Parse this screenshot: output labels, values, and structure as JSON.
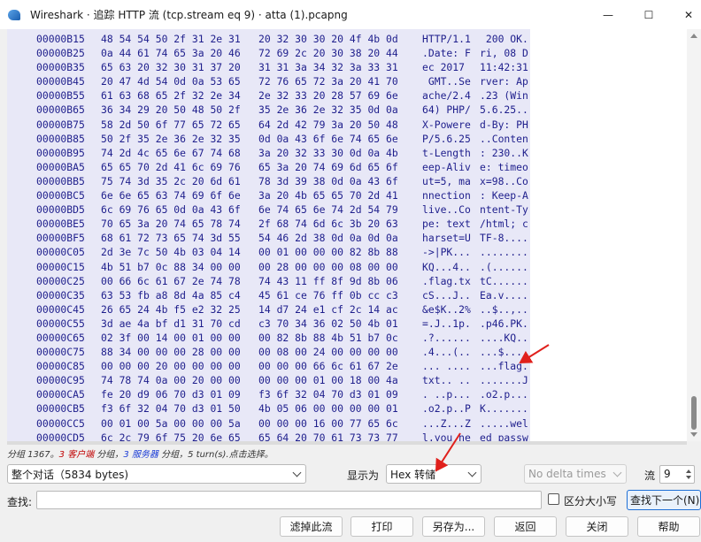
{
  "window": {
    "title": "Wireshark · 追踪 HTTP 流 (tcp.stream eq 9) · atta (1).pcapng",
    "minimize_glyph": "—",
    "maximize_glyph": "☐",
    "close_glyph": "✕",
    "app_icon": "wireshark-fin-icon"
  },
  "hex_dump": {
    "rows": [
      {
        "offset": "00000B15",
        "hex_a": "48 54 54 50 2f 31 2e 31",
        "hex_b": "20 32 30 30 20 4f 4b 0d",
        "ascii_a": "HTTP/1.1",
        "ascii_b": " 200 OK."
      },
      {
        "offset": "00000B25",
        "hex_a": "0a 44 61 74 65 3a 20 46",
        "hex_b": "72 69 2c 20 30 38 20 44",
        "ascii_a": ".Date: F",
        "ascii_b": "ri, 08 D"
      },
      {
        "offset": "00000B35",
        "hex_a": "65 63 20 32 30 31 37 20",
        "hex_b": "31 31 3a 34 32 3a 33 31",
        "ascii_a": "ec 2017 ",
        "ascii_b": "11:42:31"
      },
      {
        "offset": "00000B45",
        "hex_a": "20 47 4d 54 0d 0a 53 65",
        "hex_b": "72 76 65 72 3a 20 41 70",
        "ascii_a": " GMT..Se",
        "ascii_b": "rver: Ap"
      },
      {
        "offset": "00000B55",
        "hex_a": "61 63 68 65 2f 32 2e 34",
        "hex_b": "2e 32 33 20 28 57 69 6e",
        "ascii_a": "ache/2.4",
        "ascii_b": ".23 (Win"
      },
      {
        "offset": "00000B65",
        "hex_a": "36 34 29 20 50 48 50 2f",
        "hex_b": "35 2e 36 2e 32 35 0d 0a",
        "ascii_a": "64) PHP/",
        "ascii_b": "5.6.25.."
      },
      {
        "offset": "00000B75",
        "hex_a": "58 2d 50 6f 77 65 72 65",
        "hex_b": "64 2d 42 79 3a 20 50 48",
        "ascii_a": "X-Powere",
        "ascii_b": "d-By: PH"
      },
      {
        "offset": "00000B85",
        "hex_a": "50 2f 35 2e 36 2e 32 35",
        "hex_b": "0d 0a 43 6f 6e 74 65 6e",
        "ascii_a": "P/5.6.25",
        "ascii_b": "..Conten"
      },
      {
        "offset": "00000B95",
        "hex_a": "74 2d 4c 65 6e 67 74 68",
        "hex_b": "3a 20 32 33 30 0d 0a 4b",
        "ascii_a": "t-Length",
        "ascii_b": ": 230..K"
      },
      {
        "offset": "00000BA5",
        "hex_a": "65 65 70 2d 41 6c 69 76",
        "hex_b": "65 3a 20 74 69 6d 65 6f",
        "ascii_a": "eep-Aliv",
        "ascii_b": "e: timeo"
      },
      {
        "offset": "00000BB5",
        "hex_a": "75 74 3d 35 2c 20 6d 61",
        "hex_b": "78 3d 39 38 0d 0a 43 6f",
        "ascii_a": "ut=5, ma",
        "ascii_b": "x=98..Co"
      },
      {
        "offset": "00000BC5",
        "hex_a": "6e 6e 65 63 74 69 6f 6e",
        "hex_b": "3a 20 4b 65 65 70 2d 41",
        "ascii_a": "nnection",
        "ascii_b": ": Keep-A"
      },
      {
        "offset": "00000BD5",
        "hex_a": "6c 69 76 65 0d 0a 43 6f",
        "hex_b": "6e 74 65 6e 74 2d 54 79",
        "ascii_a": "live..Co",
        "ascii_b": "ntent-Ty"
      },
      {
        "offset": "00000BE5",
        "hex_a": "70 65 3a 20 74 65 78 74",
        "hex_b": "2f 68 74 6d 6c 3b 20 63",
        "ascii_a": "pe: text",
        "ascii_b": "/html; c"
      },
      {
        "offset": "00000BF5",
        "hex_a": "68 61 72 73 65 74 3d 55",
        "hex_b": "54 46 2d 38 0d 0a 0d 0a",
        "ascii_a": "harset=U",
        "ascii_b": "TF-8...."
      },
      {
        "offset": "00000C05",
        "hex_a": "2d 3e 7c 50 4b 03 04 14",
        "hex_b": "00 01 00 00 00 82 8b 88",
        "ascii_a": "->|PK...",
        "ascii_b": "........"
      },
      {
        "offset": "00000C15",
        "hex_a": "4b 51 b7 0c 88 34 00 00",
        "hex_b": "00 28 00 00 00 08 00 00",
        "ascii_a": "KQ...4..",
        "ascii_b": ".(......"
      },
      {
        "offset": "00000C25",
        "hex_a": "00 66 6c 61 67 2e 74 78",
        "hex_b": "74 43 11 ff 8f 9d 8b 06",
        "ascii_a": ".flag.tx",
        "ascii_b": "tC......"
      },
      {
        "offset": "00000C35",
        "hex_a": "63 53 fb a8 8d 4a 85 c4",
        "hex_b": "45 61 ce 76 ff 0b cc c3",
        "ascii_a": "cS...J..",
        "ascii_b": "Ea.v...."
      },
      {
        "offset": "00000C45",
        "hex_a": "26 65 24 4b f5 e2 32 25",
        "hex_b": "14 d7 24 e1 cf 2c 14 ac",
        "ascii_a": "&e$K..2%",
        "ascii_b": "..$..,.."
      },
      {
        "offset": "00000C55",
        "hex_a": "3d ae 4a bf d1 31 70 cd",
        "hex_b": "c3 70 34 36 02 50 4b 01",
        "ascii_a": "=.J..1p.",
        "ascii_b": ".p46.PK."
      },
      {
        "offset": "00000C65",
        "hex_a": "02 3f 00 14 00 01 00 00",
        "hex_b": "00 82 8b 88 4b 51 b7 0c",
        "ascii_a": ".?......",
        "ascii_b": "....KQ.."
      },
      {
        "offset": "00000C75",
        "hex_a": "88 34 00 00 00 28 00 00",
        "hex_b": "00 08 00 24 00 00 00 00",
        "ascii_a": ".4...(..",
        "ascii_b": "...$...."
      },
      {
        "offset": "00000C85",
        "hex_a": "00 00 00 20 00 00 00 00",
        "hex_b": "00 00 00 66 6c 61 67 2e",
        "ascii_a": "... ....",
        "ascii_b": "...flag."
      },
      {
        "offset": "00000C95",
        "hex_a": "74 78 74 0a 00 20 00 00",
        "hex_b": "00 00 00 01 00 18 00 4a",
        "ascii_a": "txt.. ..",
        "ascii_b": ".......J"
      },
      {
        "offset": "00000CA5",
        "hex_a": "fe 20 d9 06 70 d3 01 09",
        "hex_b": "f3 6f 32 04 70 d3 01 09",
        "ascii_a": ". ..p...",
        "ascii_b": ".o2.p..."
      },
      {
        "offset": "00000CB5",
        "hex_a": "f3 6f 32 04 70 d3 01 50",
        "hex_b": "4b 05 06 00 00 00 00 01",
        "ascii_a": ".o2.p..P",
        "ascii_b": "K......."
      },
      {
        "offset": "00000CC5",
        "hex_a": "00 01 00 5a 00 00 00 5a",
        "hex_b": "00 00 00 16 00 77 65 6c",
        "ascii_a": "...Z...Z",
        "ascii_b": ".....wel"
      },
      {
        "offset": "00000CD5",
        "hex_a": "6c 2c 79 6f 75 20 6e 65",
        "hex_b": "65 64 20 70 61 73 73 77",
        "ascii_a": "l,you ne",
        "ascii_b": "ed passw"
      }
    ]
  },
  "stats": {
    "prefix": "分组 1367。",
    "client_count": "3",
    "client_label": "客户端",
    "mid1": " 分组，",
    "server_count": "3",
    "server_label": "服务器",
    "suffix": " 分组，5 turn(s).点击选择。"
  },
  "controls": {
    "conversation_value": "整个对话（5834 bytes)",
    "show_as_label": "显示为",
    "show_as_value": "Hex 转储",
    "delta_value": "No delta times",
    "stream_label": "流",
    "stream_value": "9"
  },
  "find": {
    "label": "查找:",
    "value": "",
    "case_label": "区分大小写",
    "find_next_label": "查找下一个(N)"
  },
  "buttons": {
    "filter": "滤掉此流",
    "print": "打印",
    "save_as": "另存为...",
    "back": "返回",
    "close": "关闭",
    "help": "帮助"
  },
  "colors": {
    "hex_text": "#1e1e8c",
    "hex_band": "#e8e8f7",
    "client": "#c00000",
    "server": "#1a3bd6",
    "annotation_arrow": "#e0201c"
  }
}
